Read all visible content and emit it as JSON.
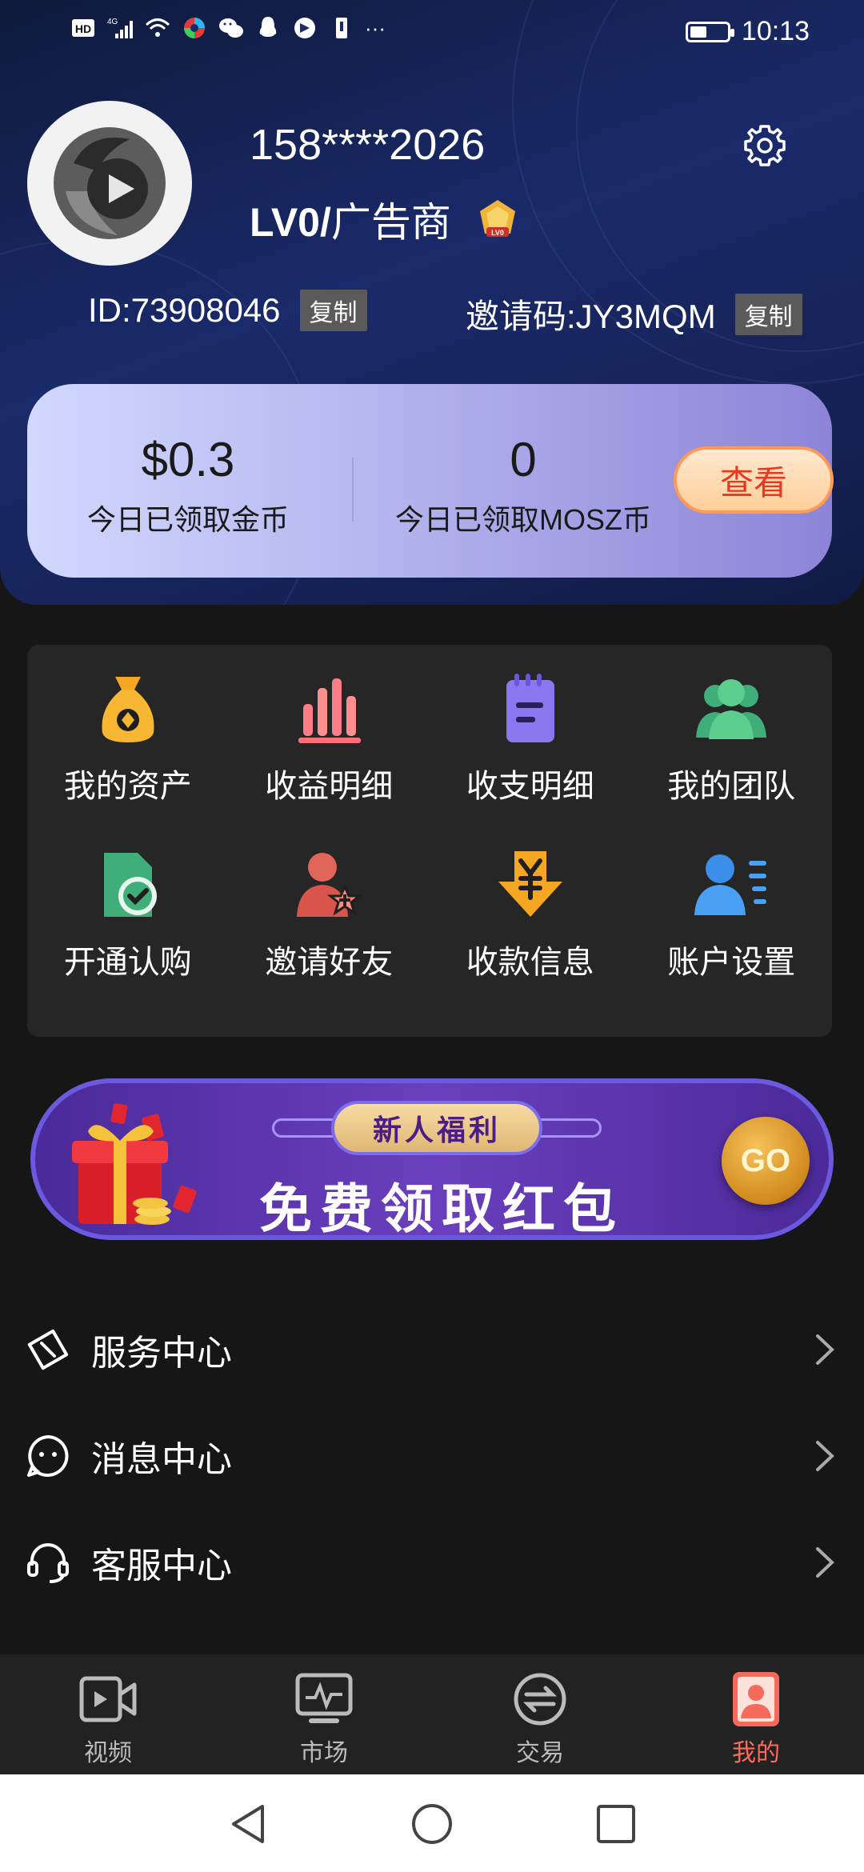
{
  "status_bar": {
    "left_icons": [
      "hd-icon",
      "signal-4g-icon",
      "wifi-icon",
      "app-icon",
      "wechat-icon",
      "qq-icon",
      "app2-icon",
      "sim-icon"
    ],
    "more": "···",
    "time": "10:13",
    "battery_level": 0.45
  },
  "profile": {
    "username": "158****2026",
    "level": "LV0/",
    "role": "广告商",
    "id_label": "ID:73908046",
    "copy_label": "复制",
    "invite_label": "邀请码:JY3MQM",
    "invite_copy_label": "复制"
  },
  "earnings_card": {
    "coins_value": "$0.3",
    "coins_label": "今日已领取金币",
    "mosz_value": "0",
    "mosz_label": "今日已领取MOSZ币",
    "view_button": "查看"
  },
  "menu_grid": [
    {
      "label": "我的资产",
      "icon": "money-bag-icon"
    },
    {
      "label": "收益明细",
      "icon": "bar-chart-icon"
    },
    {
      "label": "收支明细",
      "icon": "notepad-icon"
    },
    {
      "label": "我的团队",
      "icon": "team-icon"
    },
    {
      "label": "开通认购",
      "icon": "verified-doc-icon"
    },
    {
      "label": "邀请好友",
      "icon": "invite-user-icon"
    },
    {
      "label": "收款信息",
      "icon": "yuan-arrow-icon"
    },
    {
      "label": "账户设置",
      "icon": "user-settings-icon"
    }
  ],
  "banner": {
    "badge": "新人福利",
    "title": "免费领取红包",
    "go": "GO"
  },
  "list": [
    {
      "label": "服务中心",
      "icon": "ticket-icon"
    },
    {
      "label": "消息中心",
      "icon": "chat-bubble-icon"
    },
    {
      "label": "客服中心",
      "icon": "headset-icon"
    }
  ],
  "bottom_nav": [
    {
      "label": "视频",
      "icon": "video-camera-icon",
      "active": false
    },
    {
      "label": "市场",
      "icon": "market-monitor-icon",
      "active": false
    },
    {
      "label": "交易",
      "icon": "exchange-icon",
      "active": false
    },
    {
      "label": "我的",
      "icon": "profile-card-icon",
      "active": true
    }
  ],
  "colors": {
    "accent": "#ff6a5a",
    "card_gradient_start": "#d2d8ff",
    "card_gradient_end": "#8d84d8",
    "view_button_text": "#e8381e"
  }
}
